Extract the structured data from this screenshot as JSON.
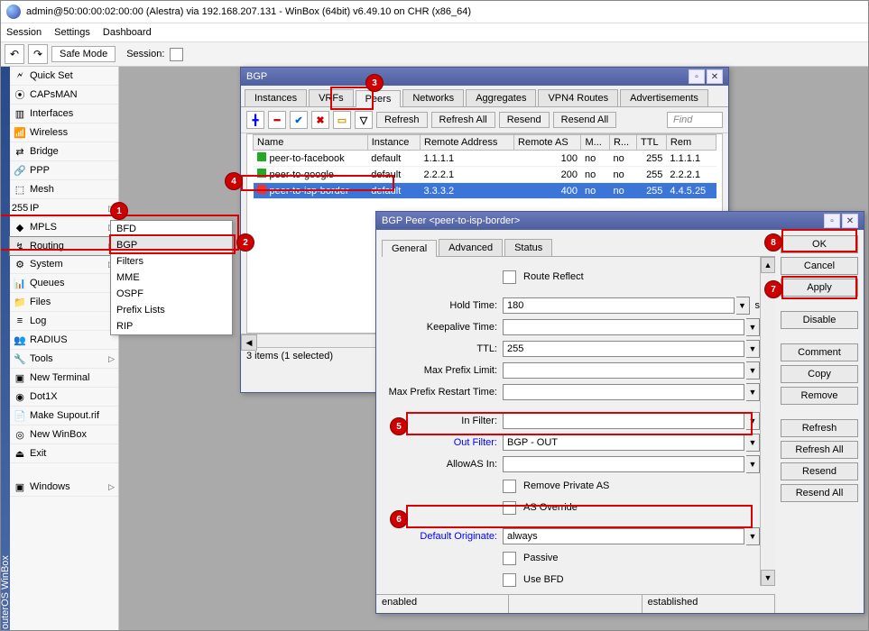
{
  "title": "admin@50:00:00:02:00:00 (Alestra) via 192.168.207.131 - WinBox (64bit) v6.49.10 on CHR (x86_64)",
  "menubar": [
    "Session",
    "Settings",
    "Dashboard"
  ],
  "toolbar": {
    "safe_mode": "Safe Mode",
    "session_label": "Session:"
  },
  "leftstrip": "outerOS  WinBox",
  "sidebar": [
    {
      "icon": "🗲",
      "label": "Quick Set"
    },
    {
      "icon": "⦿",
      "label": "CAPsMAN"
    },
    {
      "icon": "▥",
      "label": "Interfaces"
    },
    {
      "icon": "📶",
      "label": "Wireless"
    },
    {
      "icon": "⇄",
      "label": "Bridge"
    },
    {
      "icon": "🔗",
      "label": "PPP"
    },
    {
      "icon": "⬚",
      "label": "Mesh"
    },
    {
      "icon": "255",
      "label": "IP",
      "sub": true
    },
    {
      "icon": "◆",
      "label": "MPLS",
      "sub": true
    },
    {
      "icon": "↯",
      "label": "Routing",
      "sub": true,
      "selected": true
    },
    {
      "icon": "⚙",
      "label": "System",
      "sub": true
    },
    {
      "icon": "📊",
      "label": "Queues"
    },
    {
      "icon": "📁",
      "label": "Files"
    },
    {
      "icon": "≡",
      "label": "Log"
    },
    {
      "icon": "👥",
      "label": "RADIUS"
    },
    {
      "icon": "🔧",
      "label": "Tools",
      "sub": true
    },
    {
      "icon": "▣",
      "label": "New Terminal"
    },
    {
      "icon": "◉",
      "label": "Dot1X"
    },
    {
      "icon": "📄",
      "label": "Make Supout.rif"
    },
    {
      "icon": "◎",
      "label": "New WinBox"
    },
    {
      "icon": "⏏",
      "label": "Exit"
    },
    {
      "spacer": true
    },
    {
      "icon": "▣",
      "label": "Windows",
      "sub": true
    }
  ],
  "routing_submenu": [
    "BFD",
    "BGP",
    "Filters",
    "MME",
    "OSPF",
    "Prefix Lists",
    "RIP"
  ],
  "bgp_window": {
    "title": "BGP",
    "tabs": [
      "Instances",
      "VRFs",
      "Peers",
      "Networks",
      "Aggregates",
      "VPN4 Routes",
      "Advertisements"
    ],
    "active_tab": "Peers",
    "buttons": {
      "refresh": "Refresh",
      "refresh_all": "Refresh All",
      "resend": "Resend",
      "resend_all": "Resend All",
      "find": "Find"
    },
    "columns": [
      "Name",
      "Instance",
      "Remote Address",
      "Remote AS",
      "M...",
      "R...",
      "TTL",
      "Rem"
    ],
    "rows": [
      {
        "name": "peer-to-facebook",
        "instance": "default",
        "addr": "1.1.1.1",
        "as": "100",
        "m": "no",
        "r": "no",
        "ttl": "255",
        "rem": "1.1.1.1"
      },
      {
        "name": "peer-to-google",
        "instance": "default",
        "addr": "2.2.2.1",
        "as": "200",
        "m": "no",
        "r": "no",
        "ttl": "255",
        "rem": "2.2.2.1"
      },
      {
        "name": "peer-to-isp-border",
        "instance": "default",
        "addr": "3.3.3.2",
        "as": "400",
        "m": "no",
        "r": "no",
        "ttl": "255",
        "rem": "4.4.5.25",
        "selected": true
      }
    ],
    "status": "3 items (1 selected)"
  },
  "peer_window": {
    "title": "BGP Peer <peer-to-isp-border>",
    "tabs": [
      "General",
      "Advanced",
      "Status"
    ],
    "active_tab": "General",
    "buttons": [
      "OK",
      "Cancel",
      "Apply",
      "Disable",
      "Comment",
      "Copy",
      "Remove",
      "Refresh",
      "Refresh All",
      "Resend",
      "Resend All"
    ],
    "fields": {
      "route_reflect": "Route Reflect",
      "hold_time_label": "Hold Time:",
      "hold_time": "180",
      "hold_time_suffix": "s",
      "keepalive_label": "Keepalive Time:",
      "keepalive": "",
      "ttl_label": "TTL:",
      "ttl": "255",
      "max_prefix_label": "Max Prefix Limit:",
      "max_prefix": "",
      "max_prefix_restart_label": "Max Prefix Restart Time:",
      "max_prefix_restart": "",
      "in_filter_label": "In Filter:",
      "in_filter": "",
      "out_filter_label": "Out Filter:",
      "out_filter": "BGP - OUT",
      "allow_as_label": "AllowAS In:",
      "allow_as": "",
      "remove_private_as": "Remove Private AS",
      "as_override": "AS Override",
      "default_originate_label": "Default Originate:",
      "default_originate": "always",
      "passive": "Passive",
      "use_bfd": "Use BFD"
    },
    "status_left": "enabled",
    "status_right": "established"
  },
  "markers": {
    "1": "1",
    "2": "2",
    "3": "3",
    "4": "4",
    "5": "5",
    "6": "6",
    "7": "7",
    "8": "8"
  }
}
